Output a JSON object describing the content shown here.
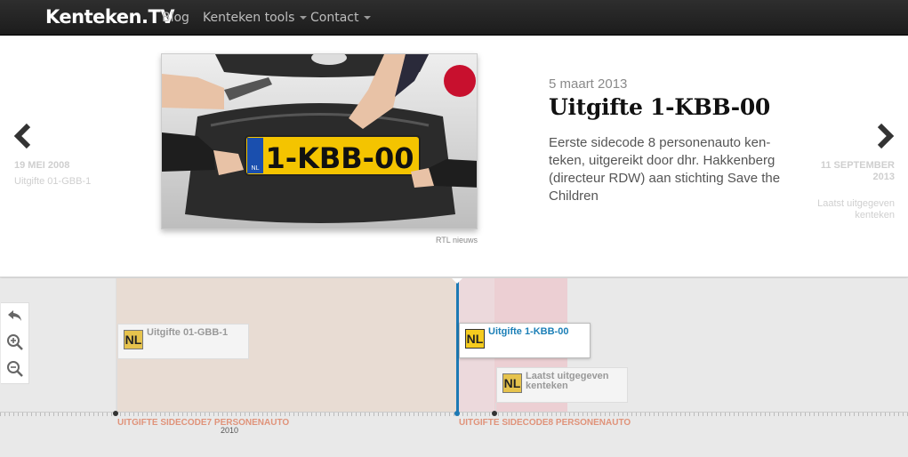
{
  "nav": {
    "brand": "Kenteken.TV",
    "items": [
      {
        "label": "Blog",
        "dropdown": false
      },
      {
        "label": "Kenteken tools",
        "dropdown": true
      },
      {
        "label": "Contact",
        "dropdown": true
      }
    ]
  },
  "slider": {
    "prev": {
      "date": "19 MEI 2008",
      "text": "Uitgifte 01-GBB-1"
    },
    "next": {
      "date": "11 SEPTEMBER 2013",
      "text": "Laatst uitgegeven kenteken"
    },
    "current": {
      "date": "5 maart 2013",
      "title": "Uitgifte 1-KBB-00",
      "body": "Eerste sidecode 8 personenauto ken-teken, uitgereikt door dhr. Hakkenberg (directeur RDW) aan stichting Save the Children",
      "photo_credit": "RTL nieuws",
      "plate_text": "1-KBB-00",
      "plate_country": "NL"
    }
  },
  "timeline": {
    "markers": [
      {
        "label": "Uitgifte 01-GBB-1",
        "flag": "NL"
      },
      {
        "label": "Uitgifte 1-KBB-00",
        "flag": "NL"
      },
      {
        "label": "Laatst uitgegeven kenteken",
        "flag": "NL"
      }
    ],
    "eras": [
      {
        "label": "UITGIFTE SIDECODE7 PERSONENAUTO"
      },
      {
        "label": "UITGIFTE SIDECODE8 PERSONENAUTO"
      }
    ],
    "year_label": "2010"
  },
  "colors": {
    "accent": "#1c79b4",
    "era_label": "#e0937a",
    "plate_yellow": "#f5cc1f"
  }
}
